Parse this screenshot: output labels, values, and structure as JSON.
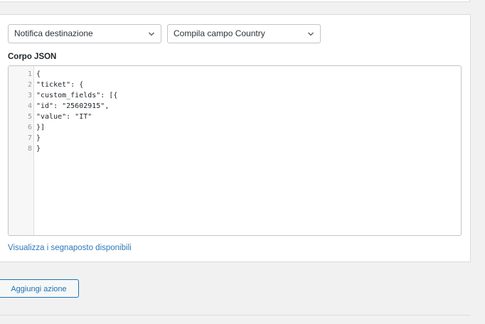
{
  "selects": {
    "notify": {
      "value": "Notifica destinazione",
      "icon": "chevron-down-icon"
    },
    "fill": {
      "value": "Compila campo Country",
      "icon": "chevron-down-icon"
    }
  },
  "json_body": {
    "label": "Corpo JSON",
    "lines": [
      {
        "number": "1",
        "text": "{"
      },
      {
        "number": "2",
        "text": "\"ticket\": {"
      },
      {
        "number": "3",
        "text": "\"custom_fields\": [{"
      },
      {
        "number": "4",
        "text": "\"id\": \"25602915\","
      },
      {
        "number": "5",
        "text": "\"value\": \"IT\""
      },
      {
        "number": "6",
        "text": "}]"
      },
      {
        "number": "7",
        "text": "}"
      },
      {
        "number": "8",
        "text": "}"
      }
    ]
  },
  "placeholders_link": "Visualizza i segnaposto disponibili",
  "add_action_label": "Aggiungi azione",
  "colors": {
    "background": "#f1f1f1",
    "panel": "#ffffff",
    "border": "#dcdcde",
    "link": "#2e78b7",
    "button_accent": "#2271b1"
  }
}
